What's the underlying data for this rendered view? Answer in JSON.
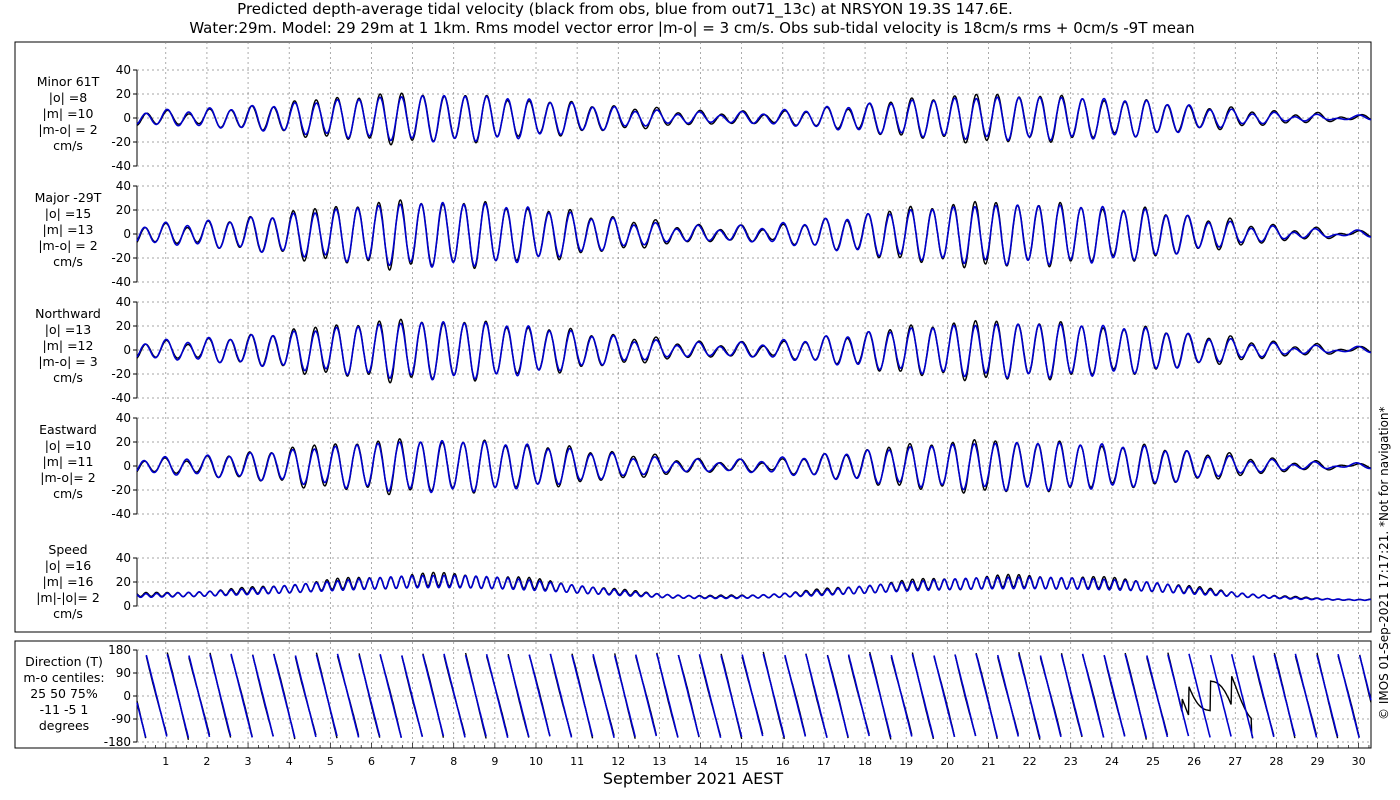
{
  "header": {
    "title_line1": "Predicted depth-average tidal velocity (black from obs, blue from out71_13c) at NRSYON 19.3S 147.6E.",
    "title_line2": "Water:29m. Model: 29 29m at 1 1km. Rms model vector error |m-o| = 3 cm/s. Obs sub-tidal velocity is 18cm/s rms + 0cm/s -9T mean"
  },
  "side_note": "© IMOS 01-Sep-2021 17:17:21. *Not for navigation*",
  "colors": {
    "obs": "#000000",
    "model": "#0000cc",
    "grid": "#888888"
  },
  "chart_data": {
    "type": "line",
    "xlabel": "September 2021 AEST",
    "xlim": [
      0.3,
      30.3
    ],
    "x_ticks": [
      1,
      2,
      3,
      4,
      5,
      6,
      7,
      8,
      9,
      10,
      11,
      12,
      13,
      14,
      15,
      16,
      17,
      18,
      19,
      20,
      21,
      22,
      23,
      24,
      25,
      26,
      27,
      28,
      29,
      30
    ],
    "x_tick_labels": [
      "1",
      "2",
      "3",
      "4",
      "5",
      "6",
      "7",
      "8",
      "9",
      "10",
      "11",
      "12",
      "13",
      "14",
      "15",
      "16",
      "17",
      "18",
      "19",
      "20",
      "21",
      "22",
      "23",
      "24",
      "25",
      "26",
      "27",
      "28",
      "29",
      "30"
    ],
    "series_names": {
      "obs": "obs",
      "model": "out71_13c"
    },
    "panels": [
      {
        "id": "minor",
        "label_lines": [
          "Minor 61T",
          "|o| =8",
          "|m| =10",
          "|m-o| = 2",
          "cm/s"
        ],
        "ylim": [
          -40,
          40
        ],
        "y_ticks": [
          -40,
          -20,
          0,
          20,
          40
        ],
        "y_tick_labels": [
          "-40",
          "-20",
          "0",
          "20",
          "40"
        ],
        "signal": {
          "kind": "tide",
          "amp_scale": 0.72,
          "phase": 0.0
        }
      },
      {
        "id": "major",
        "label_lines": [
          "Major -29T",
          "|o| =15",
          "|m| =13",
          "|m-o| = 2",
          "cm/s"
        ],
        "ylim": [
          -40,
          40
        ],
        "y_ticks": [
          -40,
          -20,
          0,
          20,
          40
        ],
        "y_tick_labels": [
          "-40",
          "-20",
          "0",
          "20",
          "40"
        ],
        "signal": {
          "kind": "tide",
          "amp_scale": 1.0,
          "phase": 0.4
        }
      },
      {
        "id": "northward",
        "label_lines": [
          "Northward",
          "|o| =13",
          "|m| =12",
          "|m-o| = 3",
          "cm/s"
        ],
        "ylim": [
          -40,
          40
        ],
        "y_ticks": [
          -40,
          -20,
          0,
          20,
          40
        ],
        "y_tick_labels": [
          "-40",
          "-20",
          "0",
          "20",
          "40"
        ],
        "signal": {
          "kind": "tide",
          "amp_scale": 0.9,
          "phase": 0.25
        }
      },
      {
        "id": "eastward",
        "label_lines": [
          "Eastward",
          "|o| =10",
          "|m| =11",
          "|m-o|= 2",
          "cm/s"
        ],
        "ylim": [
          -40,
          40
        ],
        "y_ticks": [
          -40,
          -20,
          0,
          20,
          40
        ],
        "y_tick_labels": [
          "-40",
          "-20",
          "0",
          "20",
          "40"
        ],
        "signal": {
          "kind": "tide",
          "amp_scale": 0.8,
          "phase": 0.6
        }
      },
      {
        "id": "speed",
        "label_lines": [
          "Speed",
          "|o| =16",
          "|m| =16",
          "|m|-|o|= 2",
          "cm/s"
        ],
        "ylim": [
          0,
          40
        ],
        "y_ticks": [
          0,
          20,
          40
        ],
        "y_tick_labels": [
          "0",
          "20",
          "40"
        ],
        "signal": {
          "kind": "speed"
        }
      },
      {
        "id": "direction",
        "label_lines": [
          "Direction (T)",
          "m-o centiles:",
          "25  50  75%",
          "-11  -5   1",
          "degrees"
        ],
        "ylim": [
          -180,
          180
        ],
        "y_ticks": [
          -180,
          -90,
          0,
          90,
          180
        ],
        "y_tick_labels": [
          "-180",
          "-90",
          "0",
          "90",
          "180"
        ],
        "signal": {
          "kind": "direction"
        }
      }
    ]
  }
}
